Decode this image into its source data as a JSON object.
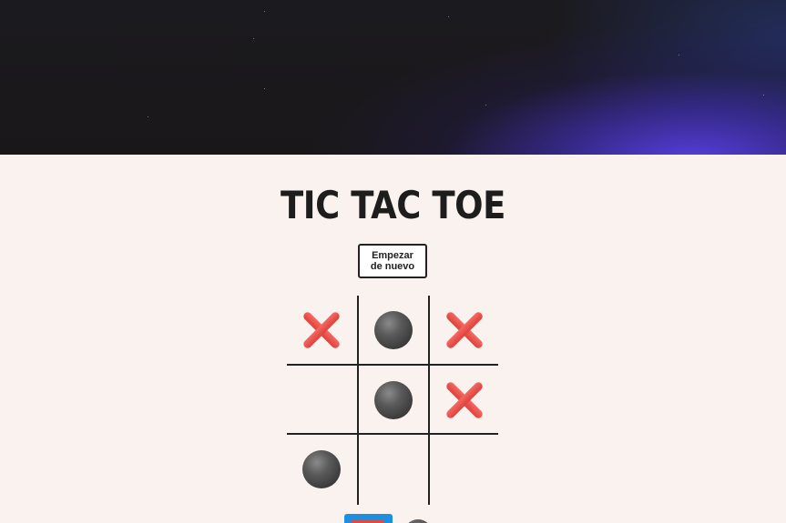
{
  "header": {
    "title": "TIC TAC TOE"
  },
  "controls": {
    "restart_label_line1": "Empezar",
    "restart_label_line2": "de nuevo"
  },
  "board": {
    "cells": [
      "X",
      "O",
      "X",
      "",
      "O",
      "X",
      "O",
      "",
      ""
    ]
  },
  "turn_indicator": {
    "players": [
      "X",
      "O"
    ],
    "active": "X"
  },
  "colors": {
    "x_mark": "#e0403b",
    "o_mark": "#4a4a4a",
    "background": "#f9f2ef",
    "active_turn": "#1e8fe0"
  },
  "icons": {
    "x": "red-cross-icon",
    "o": "black-circle-icon"
  }
}
